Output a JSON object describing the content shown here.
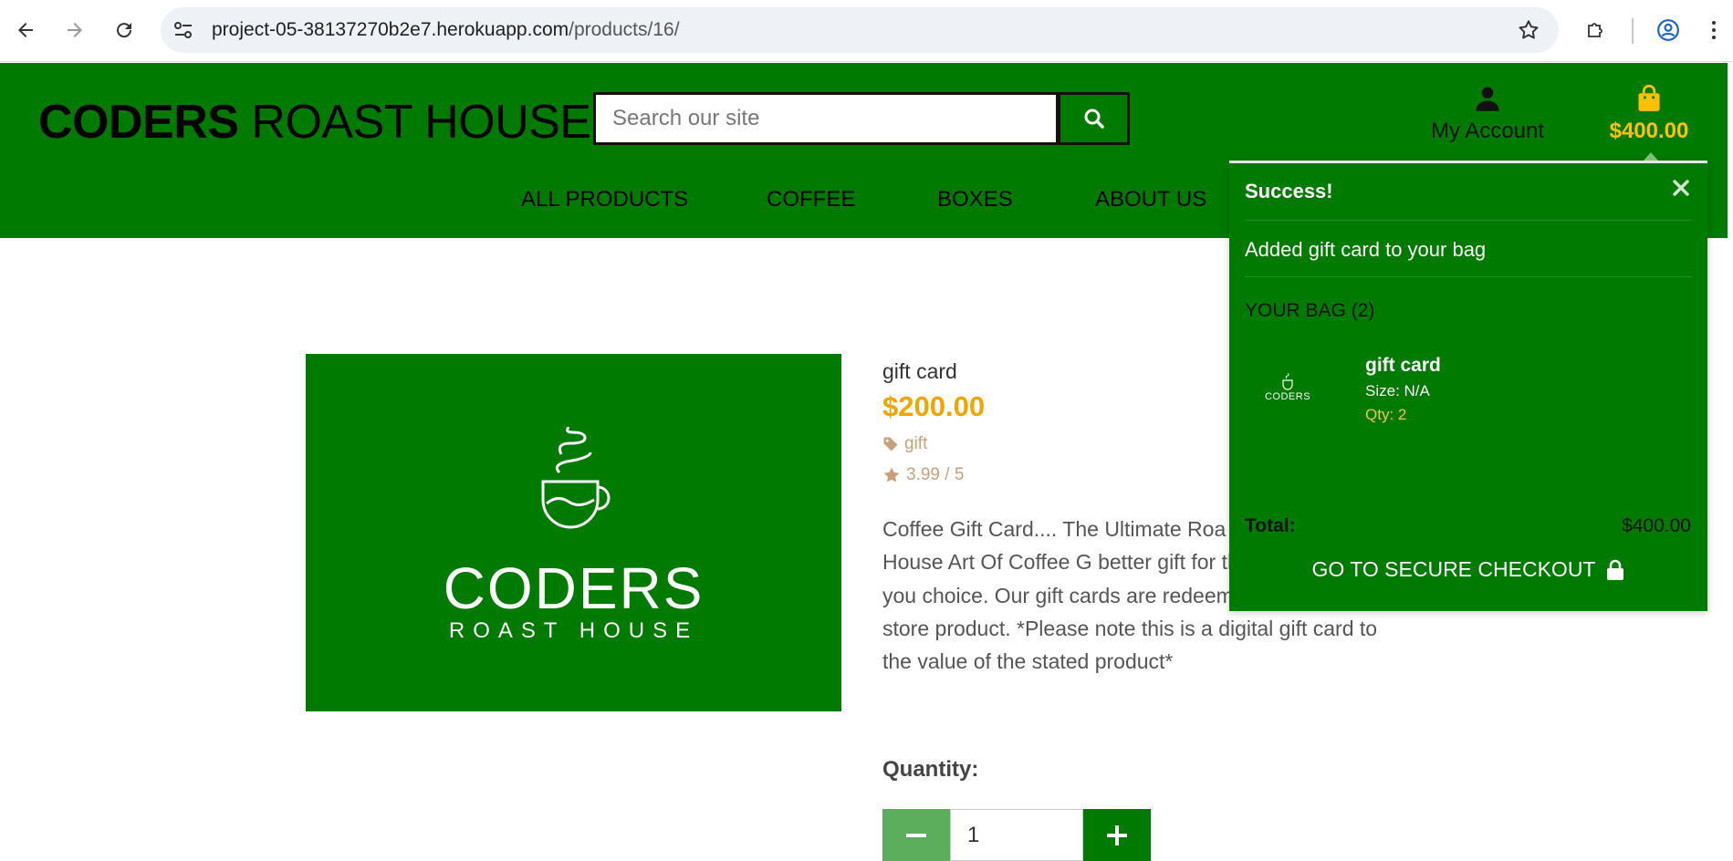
{
  "browser": {
    "url_host": "project-05-38137270b2e7.herokuapp.com",
    "url_path": "/products/16/"
  },
  "header": {
    "logo_bold": "CODERS",
    "logo_rest": " ROAST HOUSE",
    "search_placeholder": "Search our site",
    "account_label": "My Account",
    "bag_total": "$400.00"
  },
  "nav": {
    "items": [
      "ALL PRODUCTS",
      "COFFEE",
      "BOXES",
      "ABOUT US"
    ]
  },
  "product": {
    "image_brand_line1": "CODERS",
    "image_brand_line2": "ROAST HOUSE",
    "name": "gift card",
    "price": "$200.00",
    "category": "gift",
    "rating": "3.99 / 5",
    "description": "Coffee Gift Card.... The Ultimate Roa Coders Roast House Art Of Coffee G better gift for that coffee lover in you choice. Our gift cards are redeemable against any store product. *Please note this is a digital gift card to the value of the stated product*",
    "quantity_label": "Quantity:",
    "quantity_value": "1"
  },
  "toast": {
    "title": "Success!",
    "message": "Added gift card to your bag",
    "bag_title": "YOUR BAG (2)",
    "item_thumb_text": "CODERS",
    "item_name": "gift card",
    "item_size": "Size: N/A",
    "item_qty": "Qty: 2",
    "total_label": "Total:",
    "total_value": "$400.00",
    "checkout_label": "GO TO SECURE CHECKOUT"
  },
  "colors": {
    "brand_green": "#007a00",
    "price_gold": "#f0a500",
    "bag_gold": "#ffc000",
    "meta_tan": "#c8a17a"
  }
}
